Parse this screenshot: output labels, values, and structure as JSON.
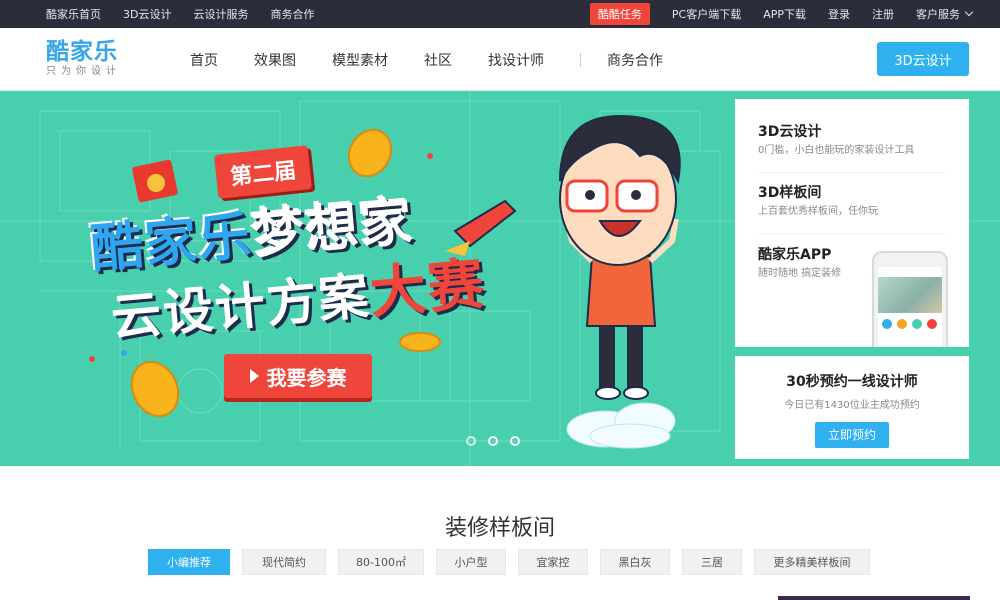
{
  "topbar": {
    "left_links": [
      "酷家乐首页",
      "3D云设计",
      "云设计服务",
      "商务合作"
    ],
    "task_badge": "酷酷任务",
    "right_links": [
      "PC客户端下载",
      "APP下载",
      "登录",
      "注册"
    ],
    "service_label": "客户服务"
  },
  "header": {
    "logo_name": "酷家乐",
    "logo_slogan": "只为你设计",
    "nav": [
      "首页",
      "效果图",
      "模型素材",
      "社区",
      "找设计师",
      "商务合作"
    ],
    "cloud_button": "3D云设计"
  },
  "banner": {
    "edition": "第二届",
    "title_line1_a": "酷家乐",
    "title_line1_b": "梦想家",
    "title_line2_a": "云设计方案",
    "title_line2_b": "大赛",
    "join_button": "我要参赛",
    "slide_count": 3,
    "active_slide": 1,
    "bg_color": "#47cfae"
  },
  "side_panel": {
    "items": [
      {
        "title": "3D云设计",
        "desc": "0门槛，小白也能玩的家装设计工具"
      },
      {
        "title": "3D样板间",
        "desc": "上百套优秀样板间，任你玩"
      },
      {
        "title": "酷家乐APP",
        "desc": "随时随地 搞定装修"
      }
    ]
  },
  "appointment": {
    "title": "30秒预约一线设计师",
    "subtitle": "今日已有1430位业主成功预约",
    "button": "立即预约"
  },
  "rooms": {
    "title": "装修样板间",
    "tabs": [
      "小编推荐",
      "现代简约",
      "80-100㎡",
      "小户型",
      "宜家控",
      "黑白灰",
      "三居",
      "更多精美样板间"
    ],
    "active_tab": 0
  },
  "colors": {
    "accent": "#2fb1f0",
    "red": "#f0453a",
    "topbar": "#2b2d3b"
  }
}
